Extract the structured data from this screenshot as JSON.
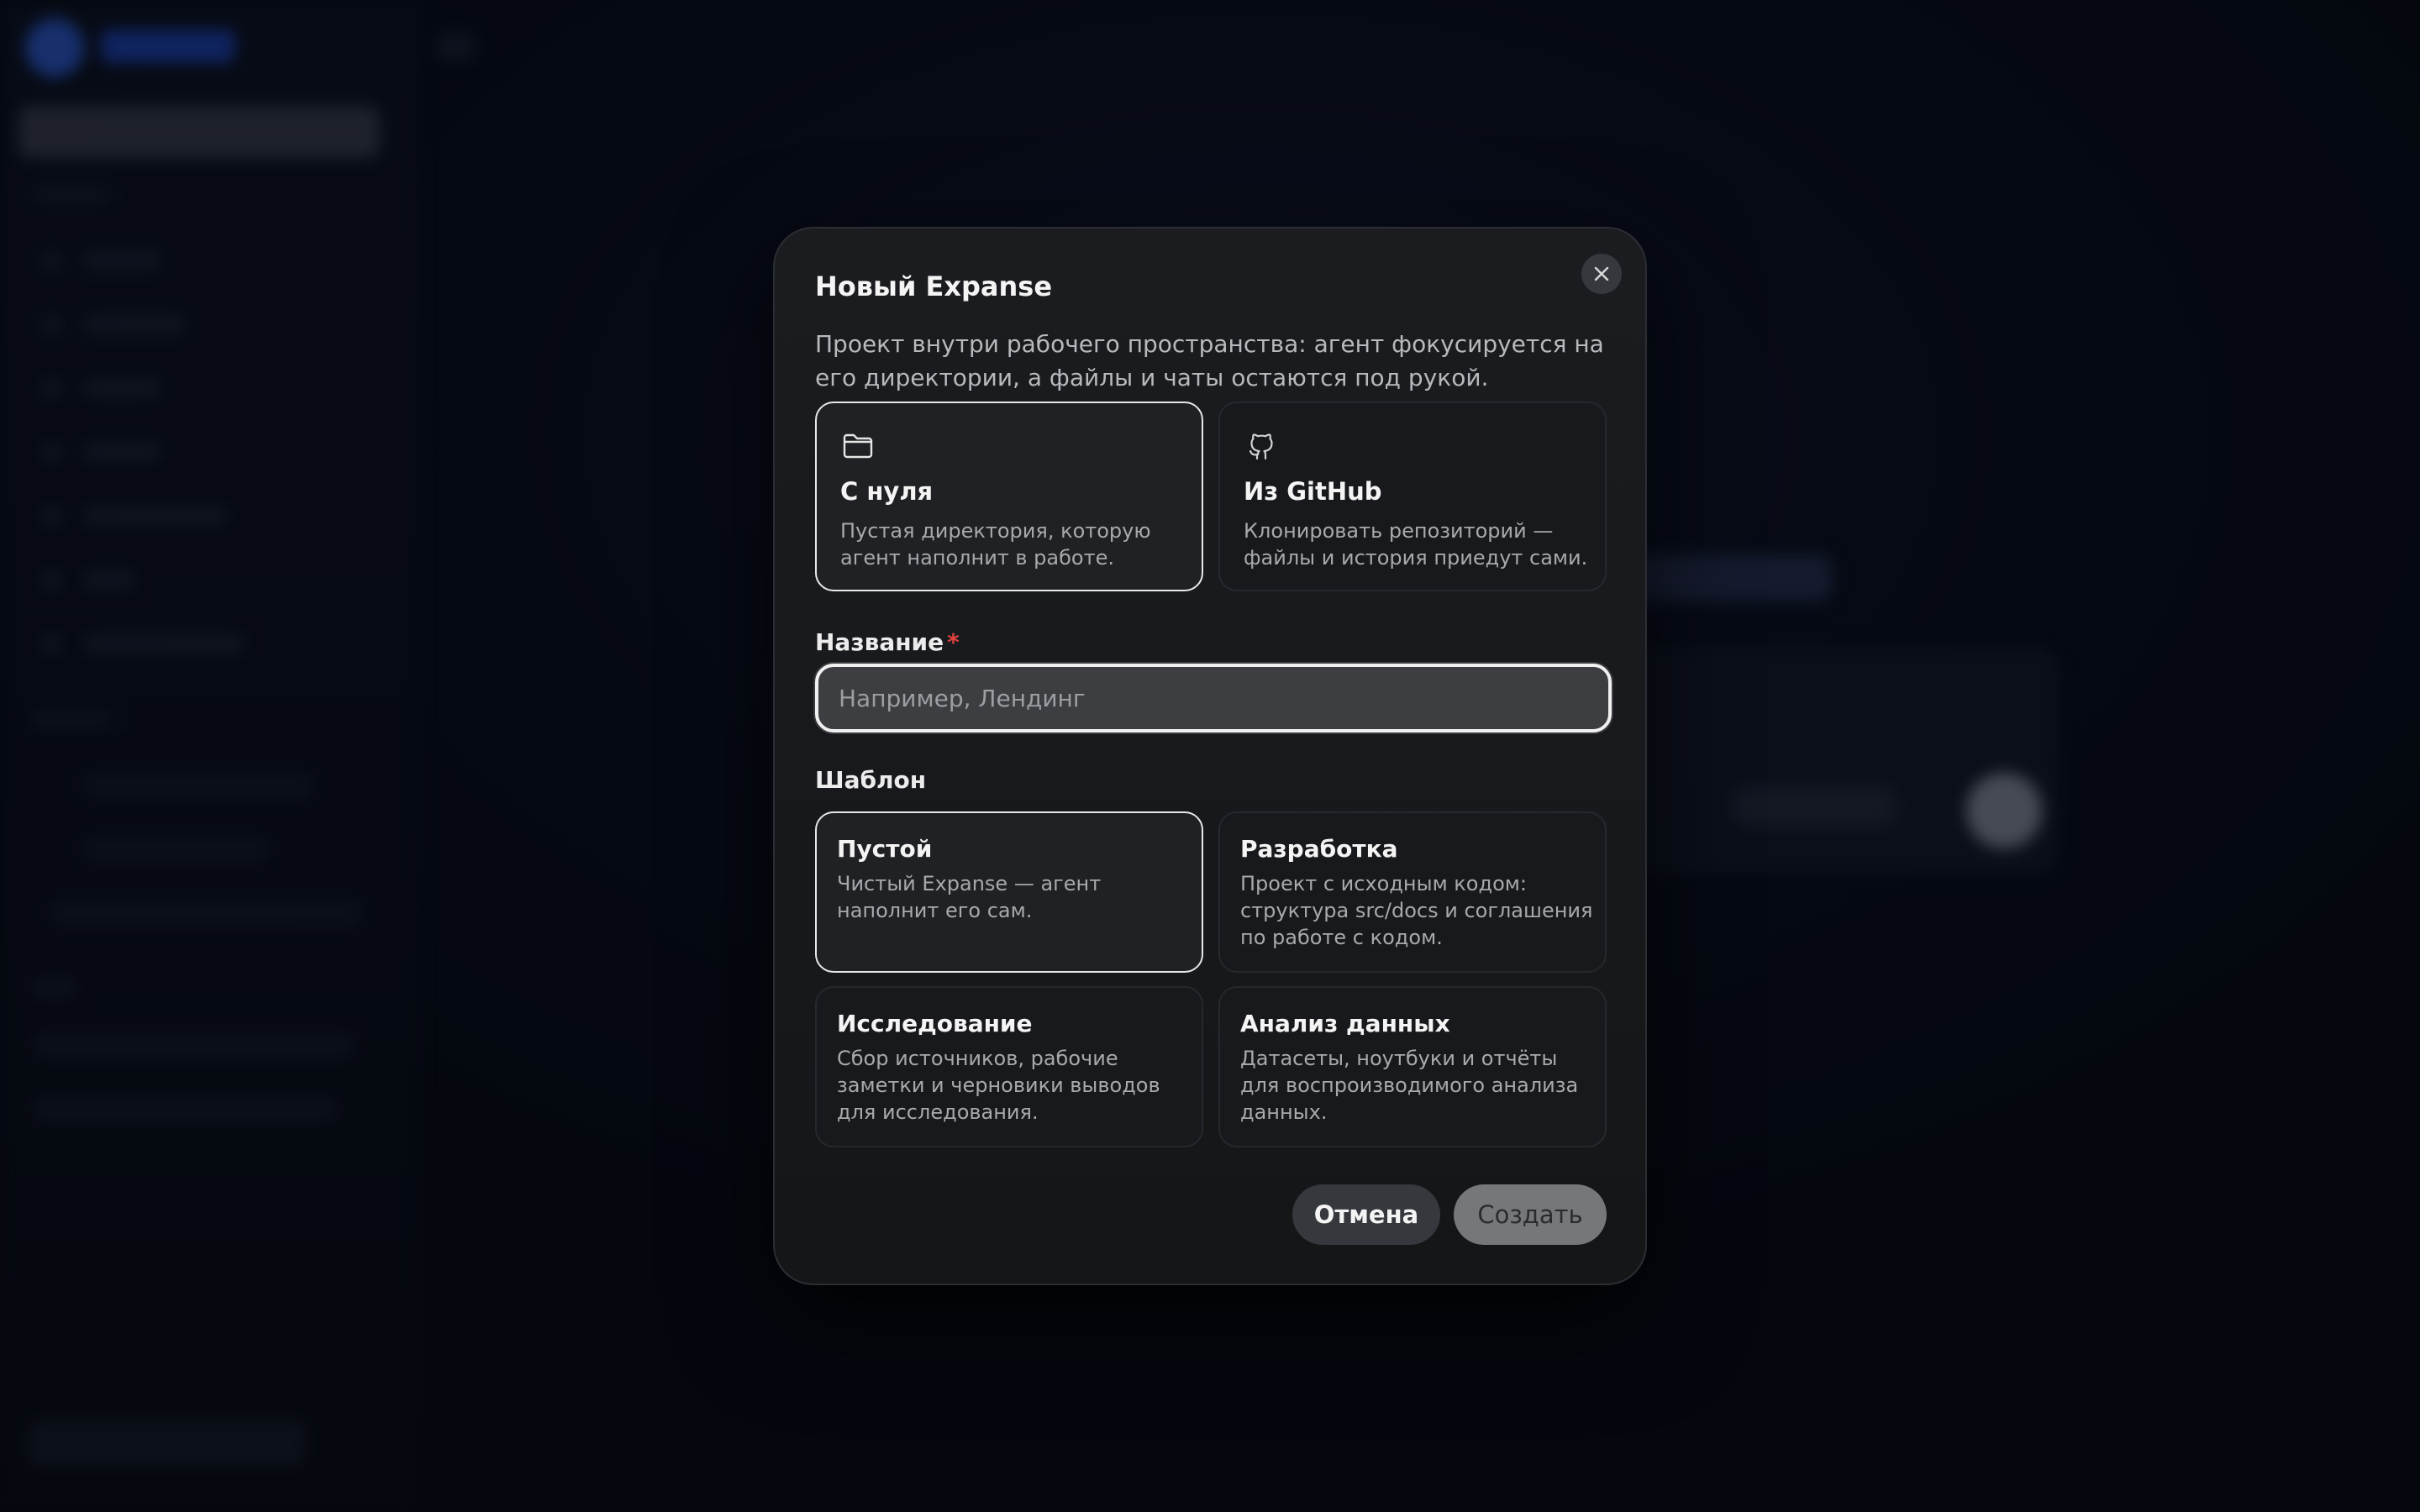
{
  "modal": {
    "title": "Новый Expanse",
    "description": "Проект внутри рабочего пространства: агент фокусируется на его директории, а файлы и чаты остаются под рукой.",
    "close_icon": "close-icon",
    "source_options": [
      {
        "title": "С нуля",
        "description": "Пустая директория, которую агент наполнит в работе.",
        "icon": "folder-icon",
        "selected": true
      },
      {
        "title": "Из GitHub",
        "description": "Клонировать репозиторий — файлы и история приедут сами.",
        "icon": "github-icon",
        "selected": false
      }
    ],
    "name_field": {
      "label": "Название",
      "required_mark": "*",
      "value": "",
      "placeholder": "Например, Лендинг"
    },
    "template_label": "Шаблон",
    "templates": [
      {
        "title": "Пустой",
        "description": "Чистый Expanse — агент наполнит его сам.",
        "selected": true
      },
      {
        "title": "Разработка",
        "description": "Проект с исходным кодом: структура src/docs и соглашения по работе с кодом.",
        "selected": false
      },
      {
        "title": "Исследование",
        "description": "Сбор источников, рабочие заметки и черновики выводов для исследования.",
        "selected": false
      },
      {
        "title": "Анализ данных",
        "description": "Датасеты, ноутбуки и отчёты для воспроизводимого анализа данных.",
        "selected": false
      }
    ],
    "cancel_label": "Отмена",
    "create_label": "Создать"
  },
  "colors": {
    "required": "#e0443c",
    "selected_border": "#e8e8e8",
    "modal_bg": "#17191c"
  }
}
